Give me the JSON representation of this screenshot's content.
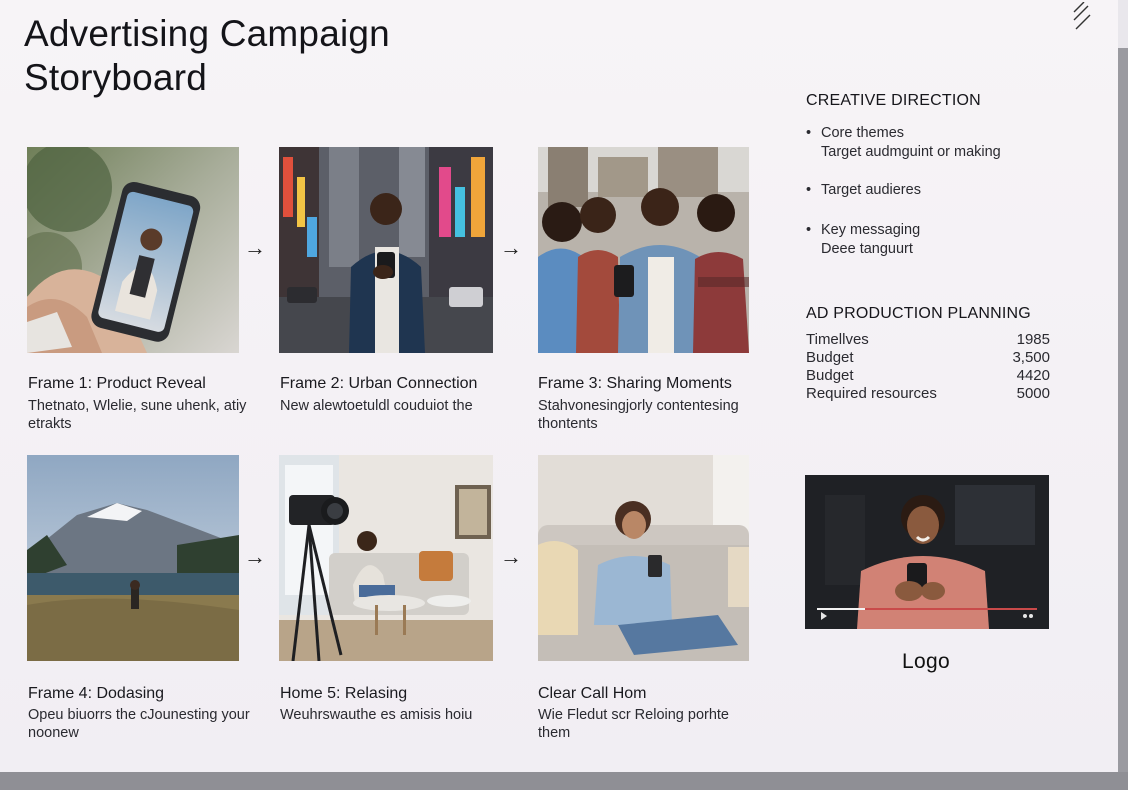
{
  "title": "Advertising Campaign Storyboard",
  "frames": [
    {
      "title": "Frame 1: Product Reveal",
      "desc": "Thetnato, Wlelie, sune uhenk, atiy etrakts",
      "image": "hand-holding-phone-image"
    },
    {
      "title": "Frame 2: Urban Connection",
      "desc": "New alewtoetuldl couduiot the",
      "image": "man-in-city-street-image"
    },
    {
      "title": "Frame 3: Sharing Moments",
      "desc": "Stahvonesingjorly contentesing thontents",
      "image": "group-of-friends-image"
    },
    {
      "title": "Frame 4: Dodasing",
      "desc": "Opeu biuorrs the cJounesting your noonew",
      "image": "mountain-lake-image"
    },
    {
      "title": "Home 5: Relasing",
      "desc": "Weuhrswauthe es amisis hoiu",
      "image": "camera-filming-living-room-image"
    },
    {
      "title": "Clear Call Hom",
      "desc": "Wie Fledut scr Reloing porhte them",
      "image": "woman-on-couch-with-phone-image"
    }
  ],
  "arrow_glyph": "→",
  "creative_direction": {
    "heading": "CREATIVE DIRECTION",
    "items": [
      {
        "label": "Core themes",
        "sub": "Target audmguint or making"
      },
      {
        "label": "Target audieres",
        "sub": ""
      },
      {
        "label": "Key messaging",
        "sub": "Deee tanguurt"
      }
    ]
  },
  "ad_production": {
    "heading": "AD PRODUCTION PLANNING",
    "rows": [
      {
        "label": "Timellves",
        "value": "1985"
      },
      {
        "label": "Budget",
        "value": "3,500"
      },
      {
        "label": "Budget",
        "value": "4420"
      },
      {
        "label": "Required resources",
        "value": "5000"
      }
    ]
  },
  "video_preview": {
    "image": "smiling-man-video-thumbnail"
  },
  "logo_text": "Logo",
  "colors": {
    "accent": "#c94a4a",
    "text": "#1d1d22",
    "background": "#f5f2f5"
  }
}
